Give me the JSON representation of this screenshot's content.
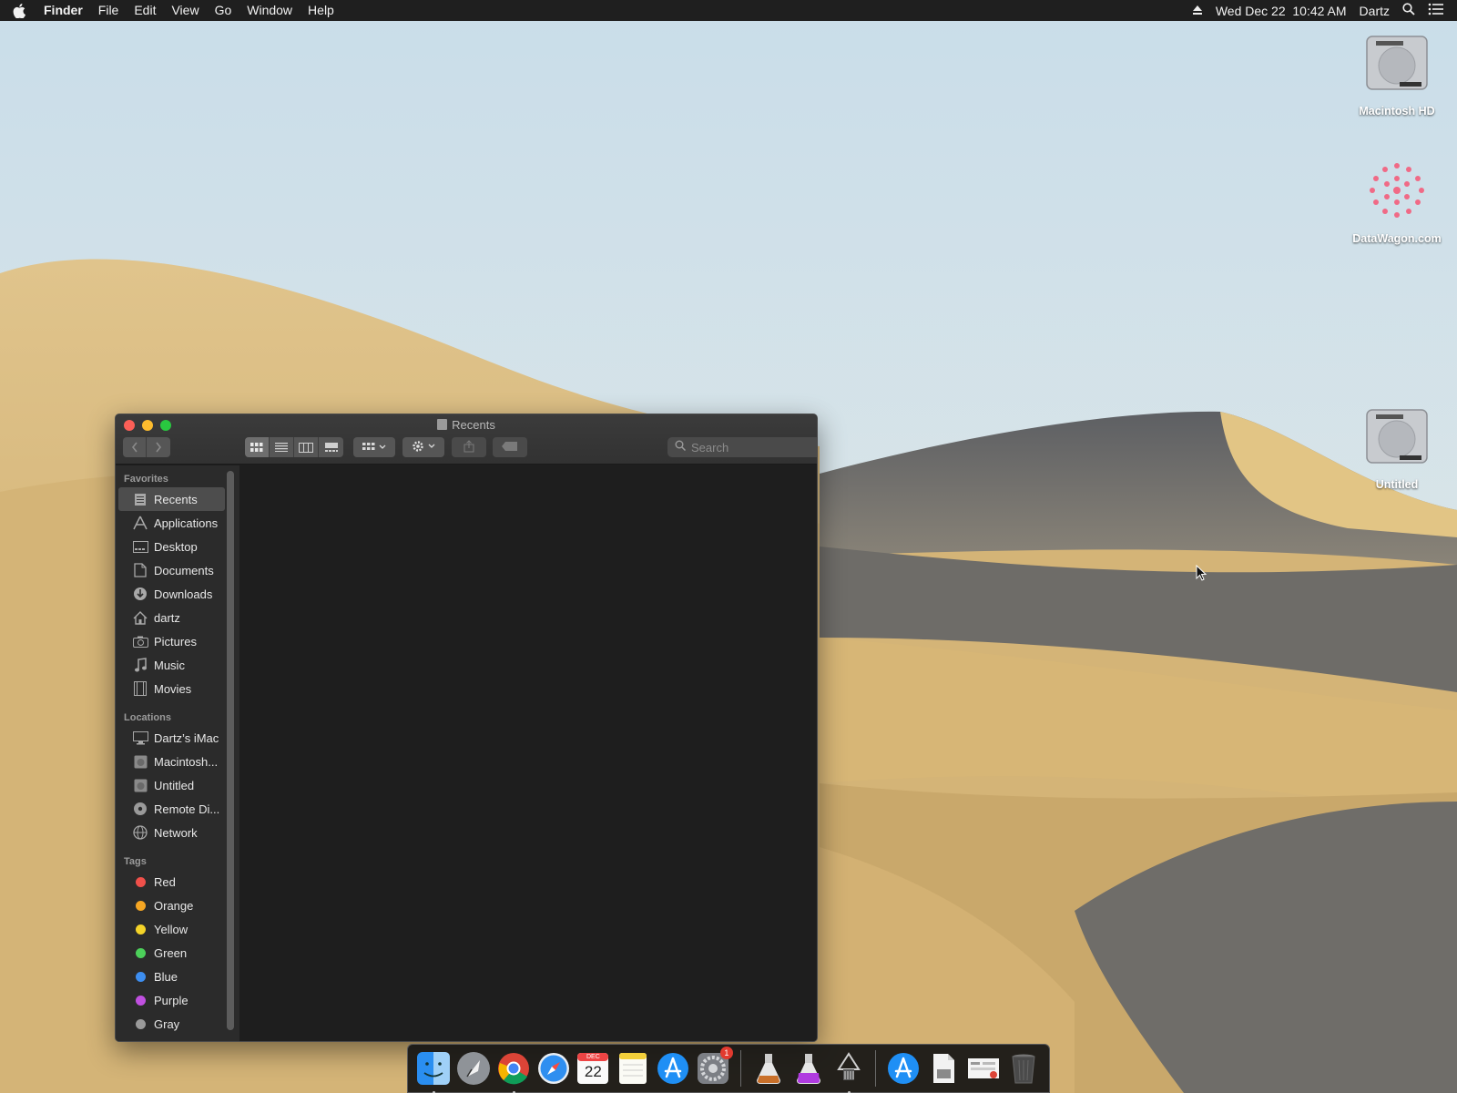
{
  "menubar": {
    "app_name": "Finder",
    "items": [
      "File",
      "Edit",
      "View",
      "Go",
      "Window",
      "Help"
    ],
    "clock": "Wed Dec 22  10:42 AM",
    "user": "Dartz"
  },
  "desktop_icons": [
    {
      "label": "Macintosh HD",
      "icon": "hard-drive-icon"
    },
    {
      "label": "DataWagon.com",
      "icon": "flower-image-icon"
    },
    {
      "label": "Untitled",
      "icon": "hard-drive-icon"
    }
  ],
  "finder": {
    "title": "Recents",
    "search_placeholder": "Search",
    "active_view": "icon",
    "sidebar": {
      "favorites_header": "Favorites",
      "favorites": [
        {
          "label": "Recents",
          "icon": "recents-icon",
          "selected": true
        },
        {
          "label": "Applications",
          "icon": "applications-icon"
        },
        {
          "label": "Desktop",
          "icon": "desktop-icon"
        },
        {
          "label": "Documents",
          "icon": "documents-icon"
        },
        {
          "label": "Downloads",
          "icon": "downloads-icon"
        },
        {
          "label": "dartz",
          "icon": "home-icon"
        },
        {
          "label": "Pictures",
          "icon": "camera-icon"
        },
        {
          "label": "Music",
          "icon": "music-note-icon"
        },
        {
          "label": "Movies",
          "icon": "film-icon"
        }
      ],
      "locations_header": "Locations",
      "locations": [
        {
          "label": "Dartz’s iMac",
          "icon": "imac-icon"
        },
        {
          "label": "Macintosh...",
          "icon": "disk-icon"
        },
        {
          "label": "Untitled",
          "icon": "disk-icon"
        },
        {
          "label": "Remote Di...",
          "icon": "optical-disc-icon"
        },
        {
          "label": "Network",
          "icon": "network-globe-icon"
        }
      ],
      "tags_header": "Tags",
      "tags": [
        {
          "label": "Red",
          "color": "#f0504a"
        },
        {
          "label": "Orange",
          "color": "#f5a623"
        },
        {
          "label": "Yellow",
          "color": "#f4d328"
        },
        {
          "label": "Green",
          "color": "#4cd05a"
        },
        {
          "label": "Blue",
          "color": "#3d8ef0"
        },
        {
          "label": "Purple",
          "color": "#c050e0"
        },
        {
          "label": "Gray",
          "color": "#9a9a9a"
        }
      ]
    }
  },
  "dock": {
    "apps": [
      {
        "name": "finder-icon",
        "running": true
      },
      {
        "name": "launchpad-icon"
      },
      {
        "name": "chrome-icon",
        "running": true
      },
      {
        "name": "safari-icon"
      },
      {
        "name": "calendar-icon",
        "month": "DEC",
        "day": "22"
      },
      {
        "name": "notes-icon"
      },
      {
        "name": "app-store-icon"
      },
      {
        "name": "system-preferences-icon",
        "badge": "1"
      },
      {
        "name": "installer-flask-icon"
      },
      {
        "name": "installer-purple-flask-icon"
      },
      {
        "name": "network-utility-icon",
        "running": true
      },
      {
        "name": "app-store-folder-icon"
      },
      {
        "name": "document-file-icon"
      },
      {
        "name": "screenshot-file-icon"
      },
      {
        "name": "trash-icon"
      }
    ]
  }
}
